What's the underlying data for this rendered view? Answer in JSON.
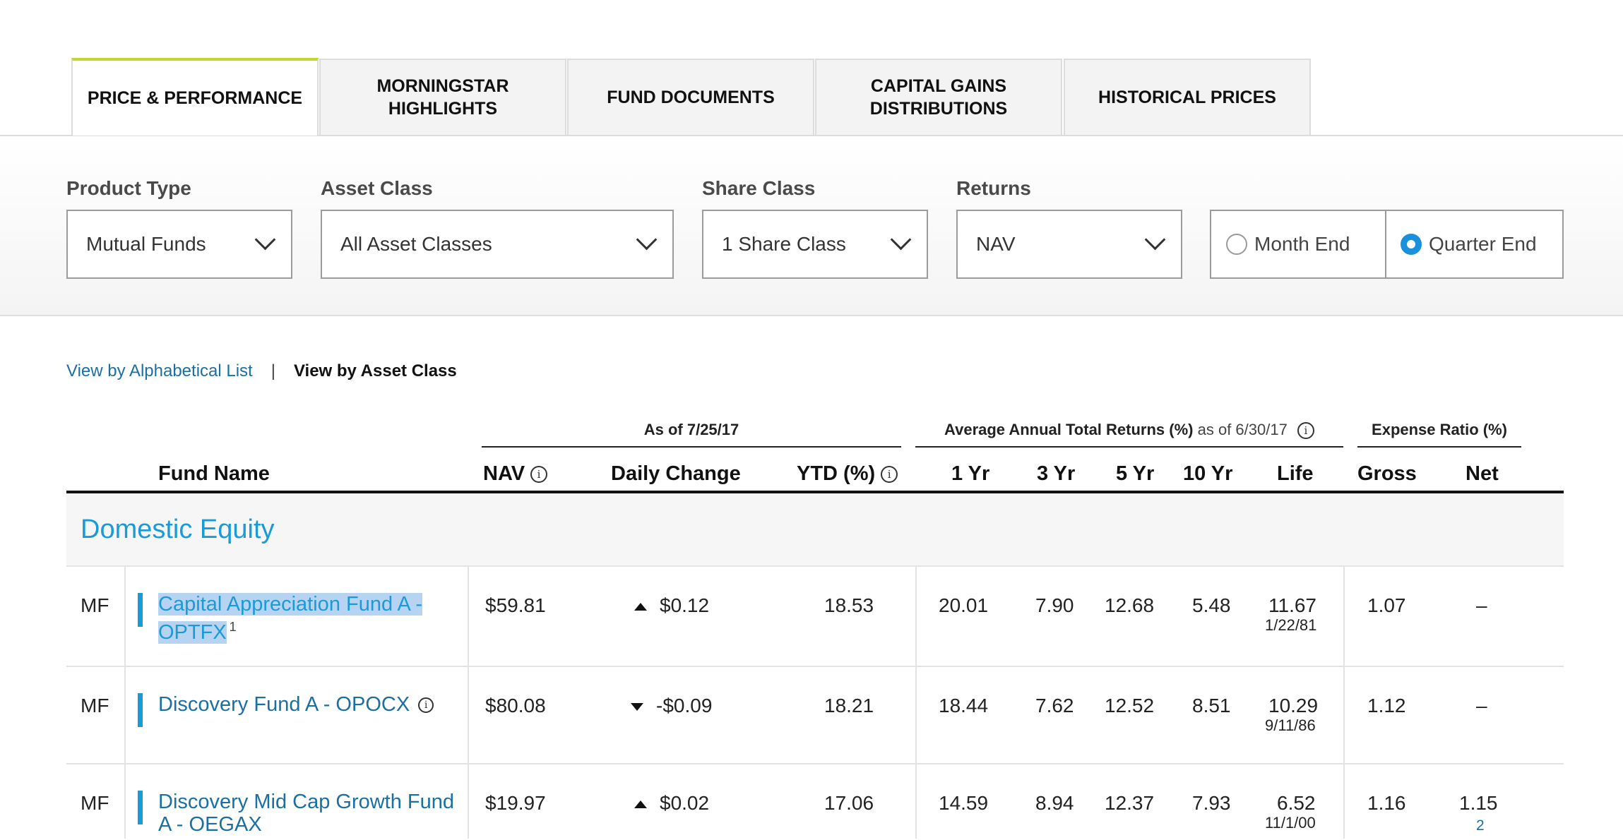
{
  "tabs": [
    {
      "label": "PRICE & PERFORMANCE",
      "active": true
    },
    {
      "label": "MORNINGSTAR\nHIGHLIGHTS",
      "active": false
    },
    {
      "label": "FUND DOCUMENTS",
      "active": false
    },
    {
      "label": "CAPITAL GAINS\nDISTRIBUTIONS",
      "active": false
    },
    {
      "label": "HISTORICAL PRICES",
      "active": false
    }
  ],
  "filters": {
    "product_type": {
      "label": "Product Type",
      "value": "Mutual Funds"
    },
    "asset_class": {
      "label": "Asset Class",
      "value": "All Asset Classes"
    },
    "share_class": {
      "label": "Share Class",
      "value": "1 Share Class"
    },
    "returns": {
      "label": "Returns",
      "value": "NAV"
    },
    "period": {
      "options": [
        "Month End",
        "Quarter End"
      ],
      "selected": "Quarter End"
    }
  },
  "view_links": {
    "alphabetical": "View by Alphabetical List",
    "separator": "|",
    "asset_class": "View by Asset Class"
  },
  "table": {
    "group_headers": {
      "as_of": "As of 7/25/17",
      "avg_returns": "Average Annual Total Returns (%)",
      "avg_returns_date": "as of 6/30/17",
      "expense": "Expense Ratio (%)"
    },
    "columns": {
      "fund_name": "Fund Name",
      "nav": "NAV",
      "daily_change": "Daily Change",
      "ytd": "YTD (%)",
      "yr1": "1 Yr",
      "yr3": "3 Yr",
      "yr5": "5 Yr",
      "yr10": "10 Yr",
      "life": "Life",
      "gross": "Gross",
      "net": "Net"
    },
    "section": "Domestic Equity",
    "rows": [
      {
        "type": "MF",
        "name_line1": "Capital Appreciation Fund A -",
        "name_line2": "OPTFX",
        "footnote": "1",
        "nav": "$59.81",
        "direction": "up",
        "daily_change": "$0.12",
        "ytd": "18.53",
        "yr1": "20.01",
        "yr3": "7.90",
        "yr5": "12.68",
        "yr10": "5.48",
        "life": "11.67",
        "life_date": "1/22/81",
        "gross": "1.07",
        "net": "–"
      },
      {
        "type": "MF",
        "name_line1": "Discovery Fund A - OPOCX",
        "name_line2": "",
        "nav": "$80.08",
        "direction": "down",
        "daily_change": "-$0.09",
        "ytd": "18.21",
        "yr1": "18.44",
        "yr3": "7.62",
        "yr5": "12.52",
        "yr10": "8.51",
        "life": "10.29",
        "life_date": "9/11/86",
        "gross": "1.12",
        "net": "–"
      },
      {
        "type": "MF",
        "name_line1": "Discovery Mid Cap Growth Fund",
        "name_line2": "A - OEGAX",
        "nav": "$19.97",
        "direction": "up",
        "daily_change": "$0.02",
        "ytd": "17.06",
        "yr1": "14.59",
        "yr3": "8.94",
        "yr5": "12.37",
        "yr10": "7.93",
        "life": "6.52",
        "life_date": "11/1/00",
        "gross": "1.16",
        "net": "1.15",
        "net_note": "2"
      }
    ]
  }
}
